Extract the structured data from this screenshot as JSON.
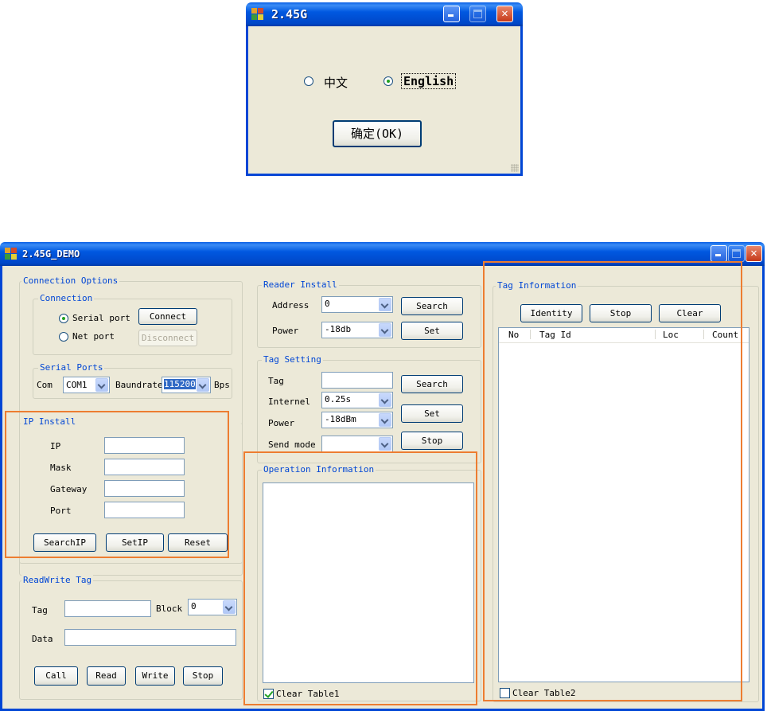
{
  "colors": {
    "title_blue": "#0046d5",
    "highlight": "#ed7d31",
    "window_bg": "#ece9d8"
  },
  "dialog": {
    "title": "2.45G",
    "lang_options": [
      "中文",
      "English"
    ],
    "selected": "English",
    "ok_label": "确定(OK)"
  },
  "app": {
    "title": "2.45G_DEMO",
    "connection_options": {
      "legend": "Connection Options",
      "connection": {
        "legend": "Connection",
        "serial": "Serial port",
        "net": "Net port",
        "connect": "Connect",
        "disconnect": "Disconnect",
        "selected": "Serial port"
      },
      "serial_ports": {
        "legend": "Serial Ports",
        "com_label": "Com",
        "com_value": "COM1",
        "baud_label": "Baundrate",
        "baud_value": "115200",
        "bps": "Bps"
      }
    },
    "ip_install": {
      "legend": "IP Install",
      "ip": "IP",
      "mask": "Mask",
      "gateway": "Gateway",
      "port": "Port",
      "search": "SearchIP",
      "set": "SetIP",
      "reset": "Reset"
    },
    "readwrite": {
      "legend": "ReadWrite Tag",
      "tag": "Tag",
      "block": "Block",
      "block_value": "0",
      "data": "Data",
      "call": "Call",
      "read": "Read",
      "write": "Write",
      "stop": "Stop"
    },
    "reader_install": {
      "legend": "Reader Install",
      "address": "Address",
      "address_value": "0",
      "power": "Power",
      "power_value": "-18db",
      "search": "Search",
      "set": "Set"
    },
    "tag_setting": {
      "legend": "Tag Setting",
      "tag": "Tag",
      "internel": "Internel",
      "internel_value": "0.25s",
      "power": "Power",
      "power_value": "-18dBm",
      "send_mode": "Send mode",
      "search": "Search",
      "set": "Set",
      "stop": "Stop"
    },
    "operation": {
      "legend": "Operation Information",
      "clear_label": "Clear Table1",
      "clear_checked": true
    },
    "tag_info": {
      "legend": "Tag Information",
      "identity": "Identity",
      "stop": "Stop",
      "clear": "Clear",
      "columns": [
        "No",
        "Tag Id",
        "Loc",
        "Count"
      ],
      "clear_label": "Clear Table2",
      "clear_checked": false
    }
  }
}
